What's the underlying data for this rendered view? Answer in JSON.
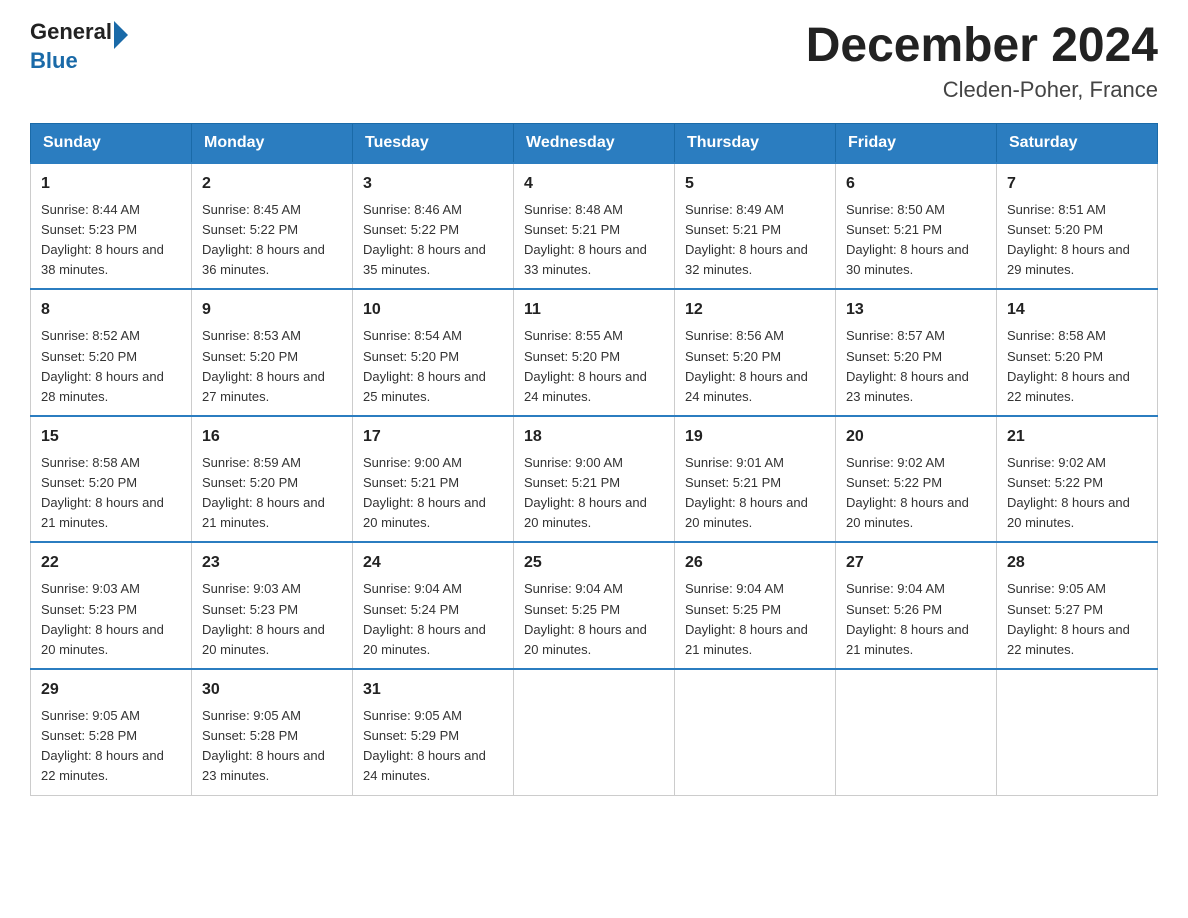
{
  "logo": {
    "text_general": "General",
    "text_blue": "Blue",
    "triangle_desc": "logo triangle arrow"
  },
  "title": {
    "month_year": "December 2024",
    "location": "Cleden-Poher, France"
  },
  "days_of_week": [
    "Sunday",
    "Monday",
    "Tuesday",
    "Wednesday",
    "Thursday",
    "Friday",
    "Saturday"
  ],
  "weeks": [
    [
      {
        "day": "1",
        "sunrise": "8:44 AM",
        "sunset": "5:23 PM",
        "daylight": "8 hours and 38 minutes."
      },
      {
        "day": "2",
        "sunrise": "8:45 AM",
        "sunset": "5:22 PM",
        "daylight": "8 hours and 36 minutes."
      },
      {
        "day": "3",
        "sunrise": "8:46 AM",
        "sunset": "5:22 PM",
        "daylight": "8 hours and 35 minutes."
      },
      {
        "day": "4",
        "sunrise": "8:48 AM",
        "sunset": "5:21 PM",
        "daylight": "8 hours and 33 minutes."
      },
      {
        "day": "5",
        "sunrise": "8:49 AM",
        "sunset": "5:21 PM",
        "daylight": "8 hours and 32 minutes."
      },
      {
        "day": "6",
        "sunrise": "8:50 AM",
        "sunset": "5:21 PM",
        "daylight": "8 hours and 30 minutes."
      },
      {
        "day": "7",
        "sunrise": "8:51 AM",
        "sunset": "5:20 PM",
        "daylight": "8 hours and 29 minutes."
      }
    ],
    [
      {
        "day": "8",
        "sunrise": "8:52 AM",
        "sunset": "5:20 PM",
        "daylight": "8 hours and 28 minutes."
      },
      {
        "day": "9",
        "sunrise": "8:53 AM",
        "sunset": "5:20 PM",
        "daylight": "8 hours and 27 minutes."
      },
      {
        "day": "10",
        "sunrise": "8:54 AM",
        "sunset": "5:20 PM",
        "daylight": "8 hours and 25 minutes."
      },
      {
        "day": "11",
        "sunrise": "8:55 AM",
        "sunset": "5:20 PM",
        "daylight": "8 hours and 24 minutes."
      },
      {
        "day": "12",
        "sunrise": "8:56 AM",
        "sunset": "5:20 PM",
        "daylight": "8 hours and 24 minutes."
      },
      {
        "day": "13",
        "sunrise": "8:57 AM",
        "sunset": "5:20 PM",
        "daylight": "8 hours and 23 minutes."
      },
      {
        "day": "14",
        "sunrise": "8:58 AM",
        "sunset": "5:20 PM",
        "daylight": "8 hours and 22 minutes."
      }
    ],
    [
      {
        "day": "15",
        "sunrise": "8:58 AM",
        "sunset": "5:20 PM",
        "daylight": "8 hours and 21 minutes."
      },
      {
        "day": "16",
        "sunrise": "8:59 AM",
        "sunset": "5:20 PM",
        "daylight": "8 hours and 21 minutes."
      },
      {
        "day": "17",
        "sunrise": "9:00 AM",
        "sunset": "5:21 PM",
        "daylight": "8 hours and 20 minutes."
      },
      {
        "day": "18",
        "sunrise": "9:00 AM",
        "sunset": "5:21 PM",
        "daylight": "8 hours and 20 minutes."
      },
      {
        "day": "19",
        "sunrise": "9:01 AM",
        "sunset": "5:21 PM",
        "daylight": "8 hours and 20 minutes."
      },
      {
        "day": "20",
        "sunrise": "9:02 AM",
        "sunset": "5:22 PM",
        "daylight": "8 hours and 20 minutes."
      },
      {
        "day": "21",
        "sunrise": "9:02 AM",
        "sunset": "5:22 PM",
        "daylight": "8 hours and 20 minutes."
      }
    ],
    [
      {
        "day": "22",
        "sunrise": "9:03 AM",
        "sunset": "5:23 PM",
        "daylight": "8 hours and 20 minutes."
      },
      {
        "day": "23",
        "sunrise": "9:03 AM",
        "sunset": "5:23 PM",
        "daylight": "8 hours and 20 minutes."
      },
      {
        "day": "24",
        "sunrise": "9:04 AM",
        "sunset": "5:24 PM",
        "daylight": "8 hours and 20 minutes."
      },
      {
        "day": "25",
        "sunrise": "9:04 AM",
        "sunset": "5:25 PM",
        "daylight": "8 hours and 20 minutes."
      },
      {
        "day": "26",
        "sunrise": "9:04 AM",
        "sunset": "5:25 PM",
        "daylight": "8 hours and 21 minutes."
      },
      {
        "day": "27",
        "sunrise": "9:04 AM",
        "sunset": "5:26 PM",
        "daylight": "8 hours and 21 minutes."
      },
      {
        "day": "28",
        "sunrise": "9:05 AM",
        "sunset": "5:27 PM",
        "daylight": "8 hours and 22 minutes."
      }
    ],
    [
      {
        "day": "29",
        "sunrise": "9:05 AM",
        "sunset": "5:28 PM",
        "daylight": "8 hours and 22 minutes."
      },
      {
        "day": "30",
        "sunrise": "9:05 AM",
        "sunset": "5:28 PM",
        "daylight": "8 hours and 23 minutes."
      },
      {
        "day": "31",
        "sunrise": "9:05 AM",
        "sunset": "5:29 PM",
        "daylight": "8 hours and 24 minutes."
      },
      null,
      null,
      null,
      null
    ]
  ],
  "labels": {
    "sunrise": "Sunrise:",
    "sunset": "Sunset:",
    "daylight": "Daylight:"
  }
}
